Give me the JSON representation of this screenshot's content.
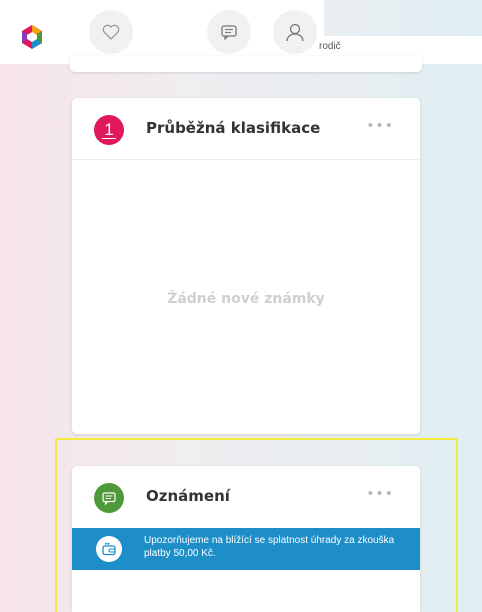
{
  "header": {
    "favorites_icon": "heart-icon",
    "messages_icon": "message-icon",
    "profile_icon": "user-icon",
    "role": "rodič",
    "colors": {
      "logo": [
        "#e0195a",
        "#f6a01a",
        "#4e9a3a",
        "#1e8ec9",
        "#8a3ab9"
      ]
    }
  },
  "grades_card": {
    "badge": "1",
    "title": "Průběžná klasifikace",
    "menu": "•••",
    "empty_message": "Žádné nové známky",
    "color": "#e0195a"
  },
  "notices_card": {
    "title": "Oznámení",
    "menu": "•••",
    "color": "#4e9a3a",
    "items": [
      {
        "text": "Upozorňujeme na blížící se splatnost úhrady za zkouška platby 50,00 Kč.",
        "icon": "wallet-icon",
        "color": "#1e8ec9"
      }
    ]
  }
}
